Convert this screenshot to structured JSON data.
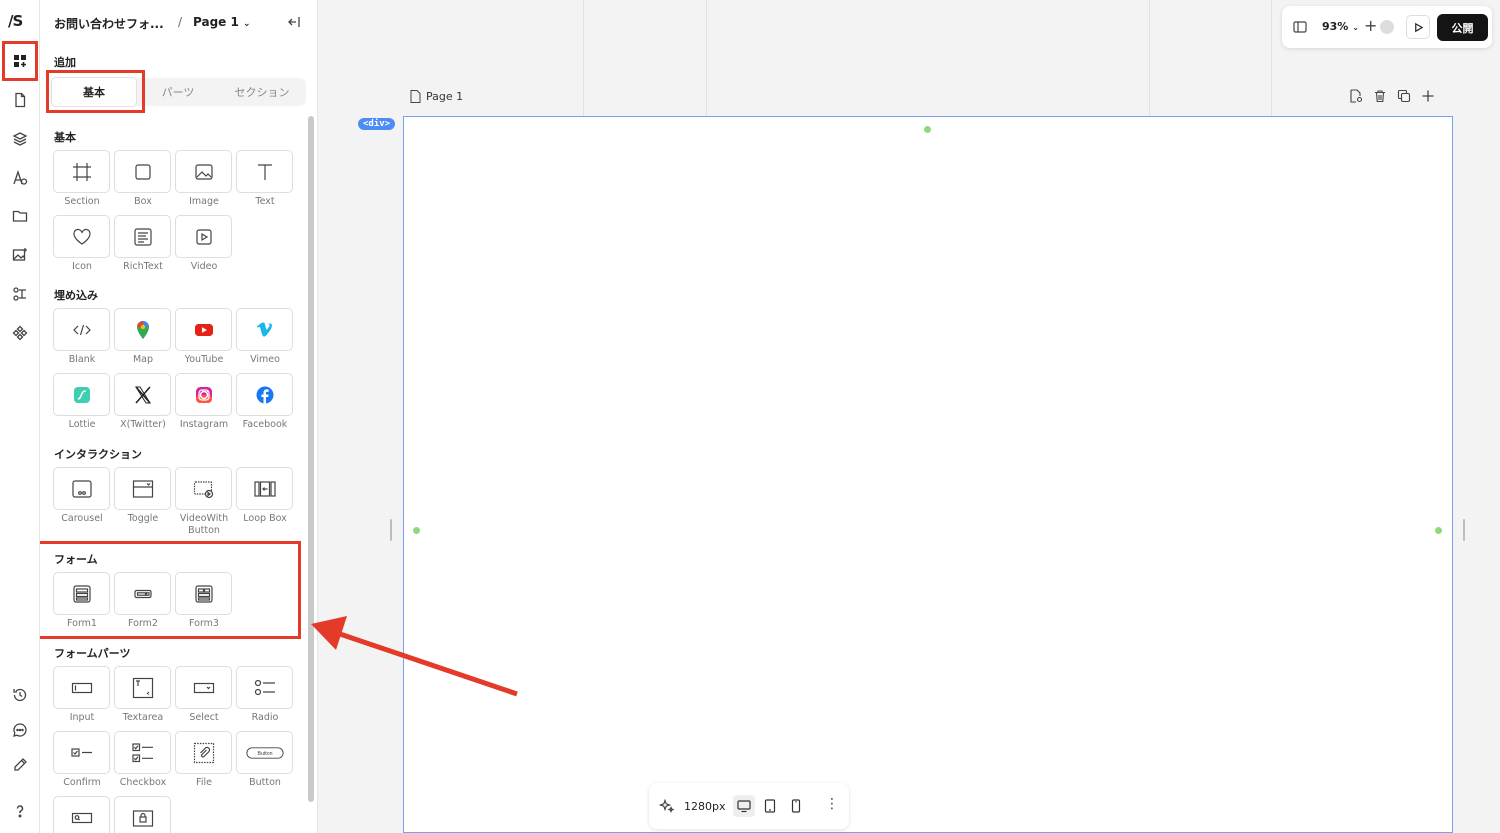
{
  "app": {
    "logo": "/S",
    "doc_title": "お問い合わせフォ...",
    "page_name": "Page 1"
  },
  "panel": {
    "add_label": "追加",
    "tabs": [
      {
        "label": "基本",
        "active": true
      },
      {
        "label": "パーツ",
        "active": false
      },
      {
        "label": "セクション",
        "active": false
      }
    ],
    "sections": {
      "basic": {
        "title": "基本",
        "items": [
          "Section",
          "Box",
          "Image",
          "Text",
          "Icon",
          "RichText",
          "Video"
        ]
      },
      "embed": {
        "title": "埋め込み",
        "items": [
          "Blank",
          "Map",
          "YouTube",
          "Vimeo",
          "Lottie",
          "X(Twitter)",
          "Instagram",
          "Facebook"
        ]
      },
      "interaction": {
        "title": "インタラクション",
        "items": [
          "Carousel",
          "Toggle",
          "VideoWith Button",
          "Loop Box"
        ]
      },
      "form": {
        "title": "フォーム",
        "items": [
          "Form1",
          "Form2",
          "Form3"
        ]
      },
      "form_parts": {
        "title": "フォームパーツ",
        "items": [
          "Input",
          "Textarea",
          "Select",
          "Radio",
          "Confirm",
          "Checkbox",
          "File",
          "Button"
        ]
      }
    }
  },
  "canvas": {
    "page_tag": "Page 1",
    "element_badge": "<div>"
  },
  "toolbar": {
    "zoom": "93%",
    "publish_label": "公開"
  },
  "device_bar": {
    "width_label": "1280px",
    "active_device": "desktop"
  },
  "colors": {
    "highlight": "#e33a2a",
    "badge": "#4e8cf5",
    "frame_border": "#7c9ff0",
    "handle_dot": "#8fd87b"
  }
}
